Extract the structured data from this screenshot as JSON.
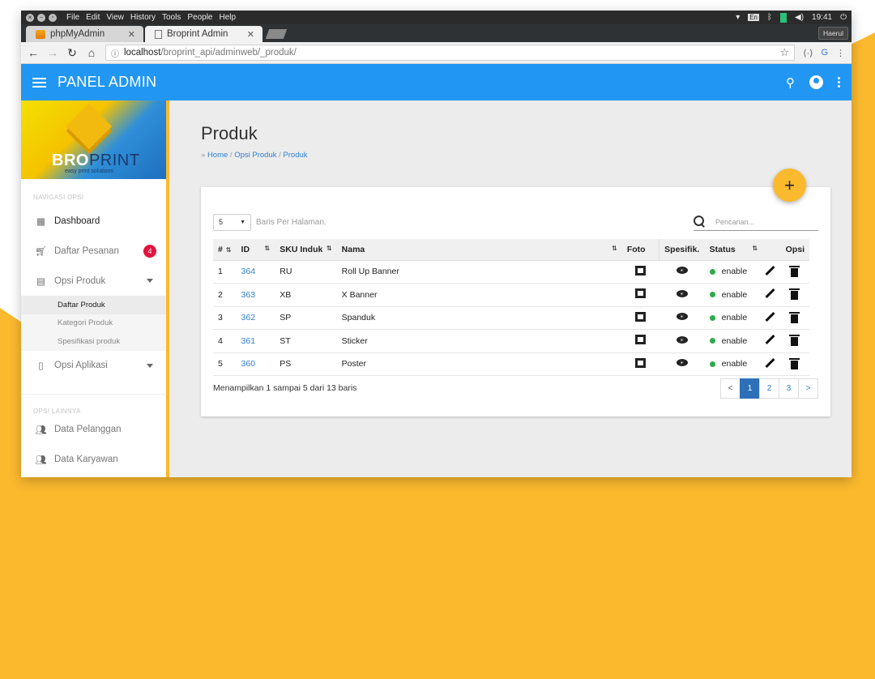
{
  "os": {
    "menu": [
      "File",
      "Edit",
      "View",
      "History",
      "Tools",
      "People",
      "Help"
    ],
    "keyboard": "En",
    "time": "19:41"
  },
  "browser": {
    "tabs": [
      {
        "label": "phpMyAdmin",
        "active": false
      },
      {
        "label": "Broprint Admin",
        "active": true
      }
    ],
    "profile": "Haerul",
    "url_host": "localhost",
    "url_path": "/broprint_api/adminweb/_produk/"
  },
  "header": {
    "title": "PANEL ADMIN"
  },
  "brand": {
    "logo_bro": "BRO",
    "logo_print": "PRINT",
    "tagline": "easy print solutions"
  },
  "sidebar": {
    "section1": "NAVIGASI OPSI",
    "section2": "OPSI LAINNYA",
    "items": [
      {
        "label": "Dashboard",
        "icon": "dashboard-icon"
      },
      {
        "label": "Daftar Pesanan",
        "icon": "cart-icon",
        "badge": "4"
      },
      {
        "label": "Opsi Produk",
        "icon": "store-icon"
      },
      {
        "label": "Opsi Aplikasi",
        "icon": "app-settings-icon"
      },
      {
        "label": "Data Pelanggan",
        "icon": "people-icon"
      },
      {
        "label": "Data Karyawan",
        "icon": "people-icon"
      }
    ],
    "subitems": [
      "Daftar Produk",
      "Kategori Produk",
      "Spesifikasi produk"
    ]
  },
  "page": {
    "title": "Produk",
    "breadcrumb": [
      "Home",
      "Opsi Produk",
      "Produk"
    ]
  },
  "table_controls": {
    "rows_per_page": "5",
    "rows_label": "Baris Per Halaman.",
    "search_placeholder": "Pencarian..."
  },
  "table": {
    "columns": [
      "#",
      "ID",
      "SKU Induk",
      "Nama",
      "Foto",
      "Spesifik.",
      "Status",
      "Opsi"
    ],
    "rows": [
      {
        "no": "1",
        "id": "364",
        "sku": "RU",
        "nama": "Roll Up Banner",
        "status": "enable"
      },
      {
        "no": "2",
        "id": "363",
        "sku": "XB",
        "nama": "X Banner",
        "status": "enable"
      },
      {
        "no": "3",
        "id": "362",
        "sku": "SP",
        "nama": "Spanduk",
        "status": "enable"
      },
      {
        "no": "4",
        "id": "361",
        "sku": "ST",
        "nama": "Sticker",
        "status": "enable"
      },
      {
        "no": "5",
        "id": "360",
        "sku": "PS",
        "nama": "Poster",
        "status": "enable"
      }
    ]
  },
  "footer": {
    "showing": "Menampilkan 1 sampai 5 dari 13 baris",
    "pagination": [
      "<",
      "1",
      "2",
      "3",
      ">"
    ],
    "current_page": "1"
  },
  "colors": {
    "primary": "#2196f3",
    "accent": "#fbb92e",
    "badge": "#e3133d",
    "status_enable": "#2eaa4a",
    "link": "#2e7fd0"
  }
}
